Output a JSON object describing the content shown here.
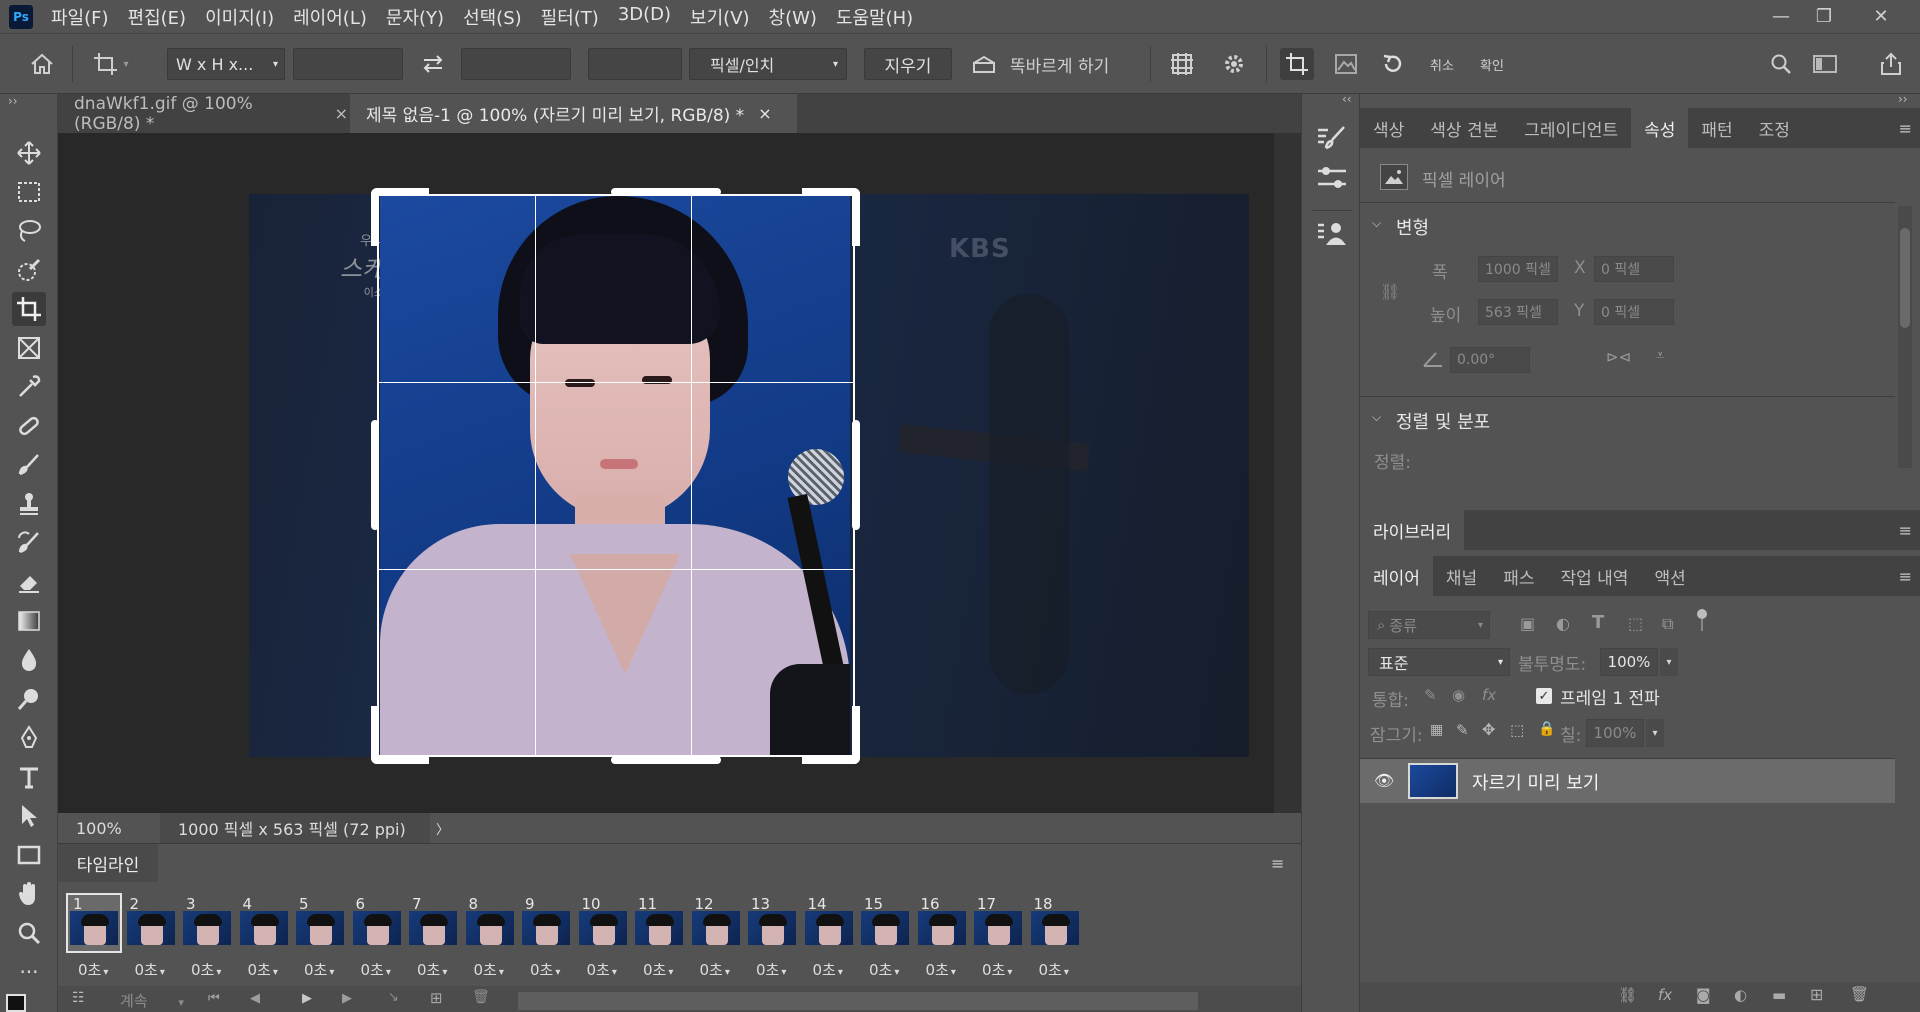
{
  "app": {
    "logo": "Ps"
  },
  "menu": [
    "파일(F)",
    "편집(E)",
    "이미지(I)",
    "레이어(L)",
    "문자(Y)",
    "선택(S)",
    "필터(T)",
    "3D(D)",
    "보기(V)",
    "창(W)",
    "도움말(H)"
  ],
  "window_controls": {
    "minimize": "—",
    "restore": "❐",
    "close": "✕"
  },
  "options_bar": {
    "ratio_select": "W x H x...",
    "unit_select": "픽셀/인치",
    "clear_button": "지우기",
    "straighten_label": "똑바르게 하기",
    "cancel_label": "취소",
    "commit_label": "확인"
  },
  "doc_tabs": [
    {
      "title": "dnaWkf1.gif @ 100% (RGB/8) *",
      "close": "×"
    },
    {
      "title": "제목 없음-1 @ 100% (자르기 미리 보기, RGB/8) *",
      "close": "×",
      "active": true
    }
  ],
  "canvas": {
    "watermark_top": "우리들의",
    "watermark_main": "스케치북",
    "watermark_sub": "이소프로",
    "broadcaster": "KBS"
  },
  "status_bar": {
    "zoom": "100%",
    "doc_info": "1000 픽셀 x 563 픽셀 (72 ppi)",
    "arrow": "〉"
  },
  "timeline": {
    "title": "타임라인",
    "frames": [
      {
        "num": "1",
        "dur": "0초"
      },
      {
        "num": "2",
        "dur": "0초"
      },
      {
        "num": "3",
        "dur": "0초"
      },
      {
        "num": "4",
        "dur": "0초"
      },
      {
        "num": "5",
        "dur": "0초"
      },
      {
        "num": "6",
        "dur": "0초"
      },
      {
        "num": "7",
        "dur": "0초"
      },
      {
        "num": "8",
        "dur": "0초"
      },
      {
        "num": "9",
        "dur": "0초"
      },
      {
        "num": "10",
        "dur": "0초"
      },
      {
        "num": "11",
        "dur": "0초"
      },
      {
        "num": "12",
        "dur": "0초"
      },
      {
        "num": "13",
        "dur": "0초"
      },
      {
        "num": "14",
        "dur": "0초"
      },
      {
        "num": "15",
        "dur": "0초"
      },
      {
        "num": "16",
        "dur": "0초"
      },
      {
        "num": "17",
        "dur": "0초"
      },
      {
        "num": "18",
        "dur": "0초"
      }
    ],
    "loop_select": "계속"
  },
  "properties_panel": {
    "tabs": [
      "색상",
      "색상 견본",
      "그레이디언트",
      "속성",
      "패턴",
      "조정"
    ],
    "layer_kind": "픽셀 레이어",
    "transform_title": "변형",
    "width_label": "폭",
    "width_value": "1000 픽셀",
    "x_label": "X",
    "x_value": "0 픽셀",
    "height_label": "높이",
    "height_value": "563 픽셀",
    "y_label": "Y",
    "y_value": "0 픽셀",
    "angle_value": "0.00°",
    "align_title": "정렬 및 분포",
    "align_label": "정렬:"
  },
  "libraries_panel": {
    "title": "라이브러리"
  },
  "layers_panel": {
    "tabs": [
      "레이어",
      "채널",
      "패스",
      "작업 내역",
      "액션"
    ],
    "filter_placeholder": "종류",
    "blend_mode": "표준",
    "opacity_label": "불투명도:",
    "opacity_value": "100%",
    "unify_label": "통합:",
    "propagate_label": "프레임 1 전파",
    "lock_label": "잠그기:",
    "fill_label": "칠:",
    "fill_value": "100%",
    "layers": [
      {
        "name": "자르기 미리 보기",
        "visible": true
      }
    ]
  }
}
